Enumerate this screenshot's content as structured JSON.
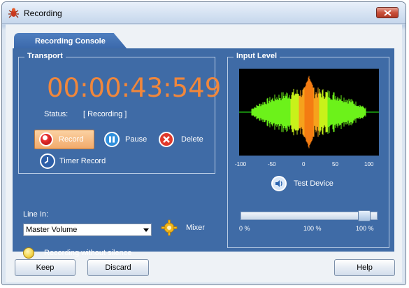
{
  "window": {
    "title": "Recording",
    "app_icon": "bug-icon",
    "close_icon": "close-icon"
  },
  "tab": {
    "label": "Recording Console"
  },
  "transport": {
    "title": "Transport",
    "timer": "00:00:43:549",
    "status_label": "Status:",
    "status_value": "[ Recording ]",
    "record_label": "Record",
    "pause_label": "Pause",
    "delete_label": "Delete",
    "timer_record_label": "Timer Record"
  },
  "input_level": {
    "title": "Input Level",
    "scale": [
      "-100",
      "-50",
      "0",
      "50",
      "100"
    ],
    "test_device_label": "Test Device",
    "slider_labels": [
      "0 %",
      "100 %",
      "100 %"
    ],
    "slider_level": 0.95
  },
  "line_in": {
    "label": "Line In:",
    "selected": "Master Volume",
    "mixer_label": "Mixer",
    "silence_label": "Recording without silence"
  },
  "footer": {
    "keep_label": "Keep",
    "discard_label": "Discard",
    "help_label": "Help"
  },
  "colors": {
    "timer": "#f0873c",
    "panel": "#3f6ba6",
    "waveform": "#7cff1a",
    "record_highlight": "#f2aa6b"
  }
}
